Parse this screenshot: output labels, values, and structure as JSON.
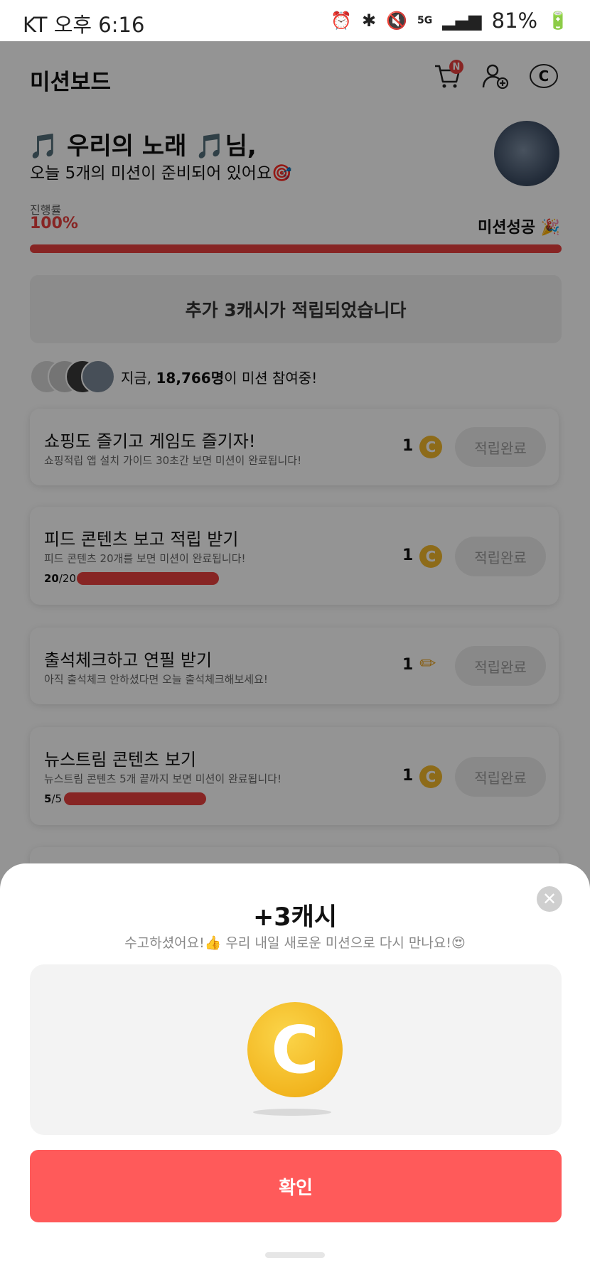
{
  "status_bar": {
    "carrier_time": "KT 오후 6:16",
    "battery": "81%",
    "network": "5G"
  },
  "header": {
    "title": "미션보드",
    "cart_badge": "N"
  },
  "greeting": {
    "line1": "🎵 우리의 노래 🎵님,",
    "line2": "오늘 5개의 미션이 준비되어 있어요🎯"
  },
  "progress": {
    "label": "진행률",
    "value": "100%",
    "status": "미션성공 🎉",
    "fraction": 1.0
  },
  "banner": {
    "text": "추가 3캐시가 적립되었습니다"
  },
  "participants": {
    "prefix": "지금, ",
    "count": "18,766명",
    "suffix": "이 미션 참여중!"
  },
  "missions": [
    {
      "title": "쇼핑도 즐기고 게임도 즐기자!",
      "subtitle": "쇼핑적립 앱 설치 가이드 30초간 보면 미션이 완료됩니다!",
      "reward": "1",
      "icon": "coin-icon",
      "button": "적립완료"
    },
    {
      "title": "피드 콘텐츠 보고 적립 받기",
      "subtitle": "피드 콘텐츠 20개를 보면 미션이 완료됩니다!",
      "reward": "1",
      "icon": "coin-icon",
      "button": "적립완료",
      "progress_done": "20",
      "progress_total": "/20"
    },
    {
      "title": "출석체크하고 연필 받기",
      "subtitle": "아직 출석체크 안하셨다면 오늘 출석체크해보세요!",
      "reward": "1",
      "icon": "pencil-icon",
      "button": "적립완료"
    },
    {
      "title": "뉴스트림 콘텐츠 보기",
      "subtitle": "뉴스트림 콘텐츠 5개 끝까지 보면 미션이 완료됩니다!",
      "reward": "1",
      "icon": "coin-icon",
      "button": "적립완료",
      "progress_done": "5",
      "progress_total": "/5"
    }
  ],
  "sheet": {
    "title": "+3캐시",
    "subtitle": "수고하셨어요!👍 우리 내일 새로운 미션으로 다시 만나요!😍",
    "confirm": "확인",
    "coin_letter": "C"
  },
  "colors": {
    "accent": "#e8403f",
    "confirm": "#ff5a5a",
    "coin": "#f3b82b"
  }
}
